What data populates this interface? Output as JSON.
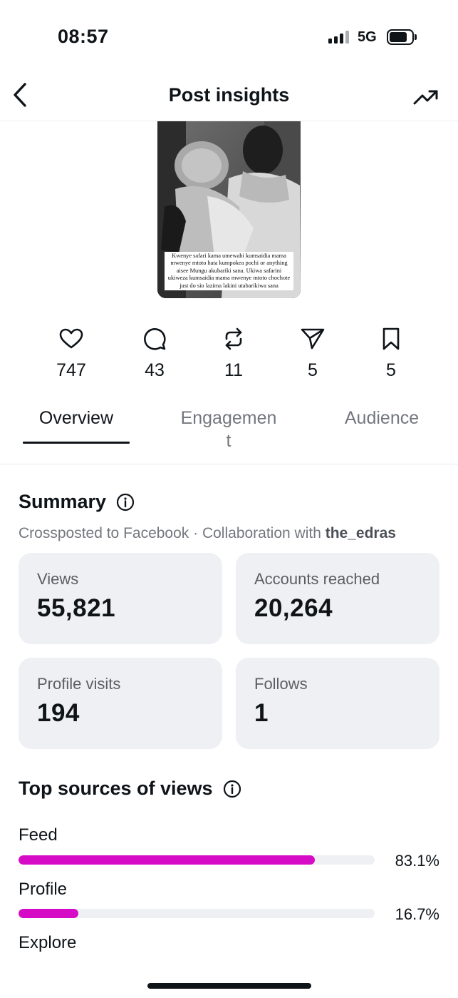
{
  "status_bar": {
    "time": "08:57",
    "network": "5G"
  },
  "header": {
    "title": "Post insights"
  },
  "post": {
    "caption": "Kwenye safari kama umewahi kumsaidia mama mwenye mtoto hata kumpokea pochi or anything aisee Mungu akubariki sana. Ukiwa safarini ukiweza kumsaidia mama mwenye mtoto chochote just do sio lazima lakini utabarikiwa sana"
  },
  "actions": [
    {
      "icon": "heart-icon",
      "count": "747"
    },
    {
      "icon": "comment-icon",
      "count": "43"
    },
    {
      "icon": "repost-icon",
      "count": "11"
    },
    {
      "icon": "share-icon",
      "count": "5"
    },
    {
      "icon": "bookmark-icon",
      "count": "5"
    }
  ],
  "tabs": [
    {
      "label": "Overview",
      "active": true
    },
    {
      "label": "Engagemen\nt",
      "active": false
    },
    {
      "label": "Audience",
      "active": false
    }
  ],
  "summary": {
    "title": "Summary",
    "sub_prefix": "Crossposted to Facebook · Collaboration with ",
    "collab_user": "the_edras",
    "cards": [
      {
        "label": "Views",
        "value": "55,821"
      },
      {
        "label": "Accounts reached",
        "value": "20,264"
      },
      {
        "label": "Profile visits",
        "value": "194"
      },
      {
        "label": "Follows",
        "value": "1"
      }
    ]
  },
  "sources": {
    "title": "Top sources of views",
    "accent": "#d60bc6",
    "items": [
      {
        "label": "Feed",
        "pct": "83.1%",
        "fraction": 0.831
      },
      {
        "label": "Profile",
        "pct": "16.7%",
        "fraction": 0.167
      },
      {
        "label": "Explore"
      }
    ]
  }
}
